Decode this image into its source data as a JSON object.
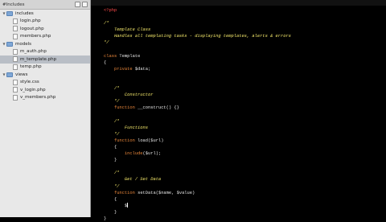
{
  "sidebar": {
    "title": "#Includes",
    "items": [
      {
        "label": "includes",
        "type": "folder",
        "indent": 0
      },
      {
        "label": "login.php",
        "type": "file",
        "indent": 1
      },
      {
        "label": "logout.php",
        "type": "file",
        "indent": 1
      },
      {
        "label": "members.php",
        "type": "file",
        "indent": 1
      },
      {
        "label": "models",
        "type": "folder",
        "indent": 0
      },
      {
        "label": "m_auth.php",
        "type": "file",
        "indent": 1
      },
      {
        "label": "m_template.php",
        "type": "file",
        "indent": 1,
        "selected": true
      },
      {
        "label": "temp.php",
        "type": "file",
        "indent": 1
      },
      {
        "label": "views",
        "type": "folder",
        "indent": 0
      },
      {
        "label": "style.css",
        "type": "file",
        "indent": 1
      },
      {
        "label": "v_login.php",
        "type": "file",
        "indent": 1
      },
      {
        "label": "v_members.php",
        "type": "file",
        "indent": 1
      }
    ]
  },
  "code": {
    "lines": [
      "<?php",
      "",
      "/*",
      "    Template Class",
      "    Handles all templating tasks - displaying templates, alerts & errors",
      "*/",
      "",
      "class Template",
      "{",
      "    private $data;",
      "",
      "",
      "    /*",
      "        Constructor",
      "    */",
      "    function __construct() {}",
      "",
      "    /*",
      "        Functions",
      "    */",
      "    function load($url)",
      "    {",
      "        include($url);",
      "    }",
      "",
      "    /*",
      "        Get / Set Data",
      "    */",
      "    function setData($name, $value)",
      "    {",
      "        $",
      "    }",
      "}"
    ]
  }
}
